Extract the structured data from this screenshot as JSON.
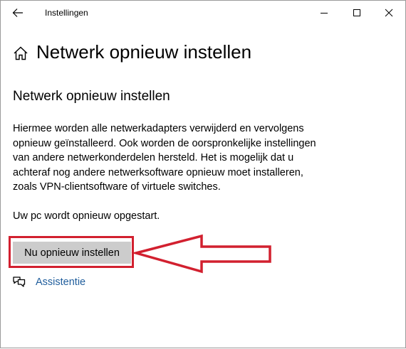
{
  "window": {
    "title": "Instellingen"
  },
  "header": {
    "page_title": "Netwerk opnieuw instellen"
  },
  "content": {
    "section_title": "Netwerk opnieuw instellen",
    "description": "Hiermee worden alle netwerkadapters verwijderd en vervolgens opnieuw geïnstalleerd. Ook worden de oorspronkelijke instellingen van andere netwerkonderdelen hersteld. Het is mogelijk dat u achteraf nog andere netwerksoftware opnieuw moet installeren, zoals VPN-clientsoftware of virtuele switches.",
    "restart_note": "Uw pc wordt opnieuw opgestart.",
    "reset_button_label": "Nu opnieuw instellen",
    "help_link_label": "Assistentie"
  },
  "icons": {
    "back": "back-arrow-icon",
    "minimize": "minimize-icon",
    "maximize": "maximize-icon",
    "close": "close-icon",
    "home": "home-icon",
    "help": "chat-bubbles-icon"
  },
  "colors": {
    "annotation_red": "#d2202f",
    "link_blue": "#1f5d9c",
    "button_gray": "#cccccc"
  }
}
